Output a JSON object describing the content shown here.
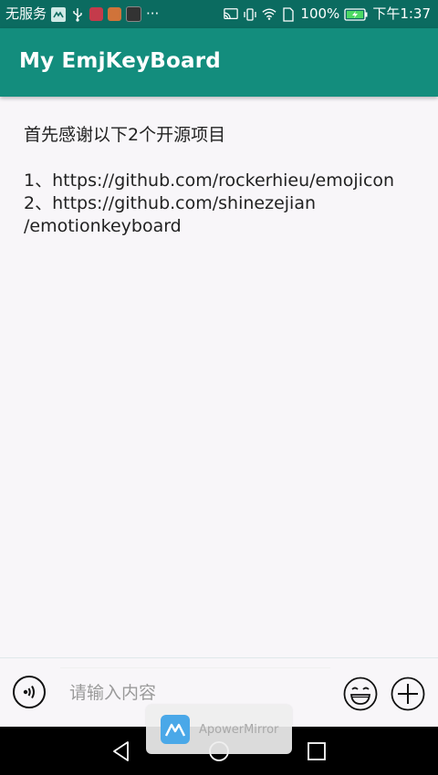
{
  "status_bar": {
    "carrier": "无服务",
    "battery": "100%",
    "time": "下午1:37",
    "more": "···",
    "icons": [
      "mirror-app-icon",
      "usb-icon",
      "huawei-icon",
      "heart-app-icon",
      "cat-app-icon",
      "cast-icon",
      "vibrate-icon",
      "wifi-icon",
      "sim-icon",
      "battery-icon"
    ]
  },
  "app_bar": {
    "title": "My EmjKeyBoard"
  },
  "content": {
    "intro": "首先感谢以下2个开源项目",
    "lines": [
      "1、https://github.com/rockerhieu/emojicon",
      "2、https://github.com/shinezejian",
      "/emotionkeyboard"
    ]
  },
  "input_bar": {
    "placeholder": "请输入内容",
    "icons": [
      "voice-icon",
      "emoji-icon",
      "plus-icon"
    ]
  },
  "overlay": {
    "label": "ApowerMirror"
  },
  "nav_bar": {
    "icons": [
      "back-icon",
      "home-icon",
      "recent-apps-icon"
    ]
  },
  "colors": {
    "status_bar": "#0b6b60",
    "app_bar": "#138d7d",
    "background": "#f8f6f9",
    "text": "#222222",
    "placeholder": "#9a9a9a"
  }
}
